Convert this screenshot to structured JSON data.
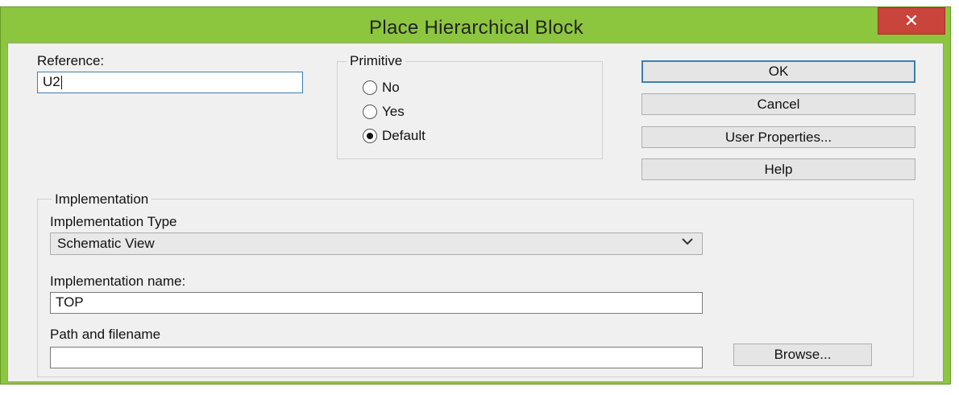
{
  "window": {
    "title": "Place Hierarchical Block",
    "close_glyph": "✕"
  },
  "reference": {
    "label": "Reference:",
    "value": "U2"
  },
  "primitive": {
    "label": "Primitive",
    "options": [
      {
        "label": "No",
        "checked": false
      },
      {
        "label": "Yes",
        "checked": false
      },
      {
        "label": "Default",
        "checked": true
      }
    ]
  },
  "buttons": {
    "ok": "OK",
    "cancel": "Cancel",
    "user_properties": "User Properties...",
    "help": "Help",
    "browse": "Browse..."
  },
  "implementation": {
    "group_label": "Implementation",
    "type_label": "Implementation Type",
    "type_value": "Schematic View",
    "name_label": "Implementation name:",
    "name_value": "TOP",
    "path_label": "Path and filename",
    "path_value": ""
  },
  "colors": {
    "title_bar": "#8cc63f",
    "close_button": "#c9443a",
    "dialog_bg": "#f0f0f0",
    "focus_border": "#3c7fb1"
  },
  "icons": {
    "close": "close-icon",
    "dropdown": "chevron-down-icon"
  }
}
